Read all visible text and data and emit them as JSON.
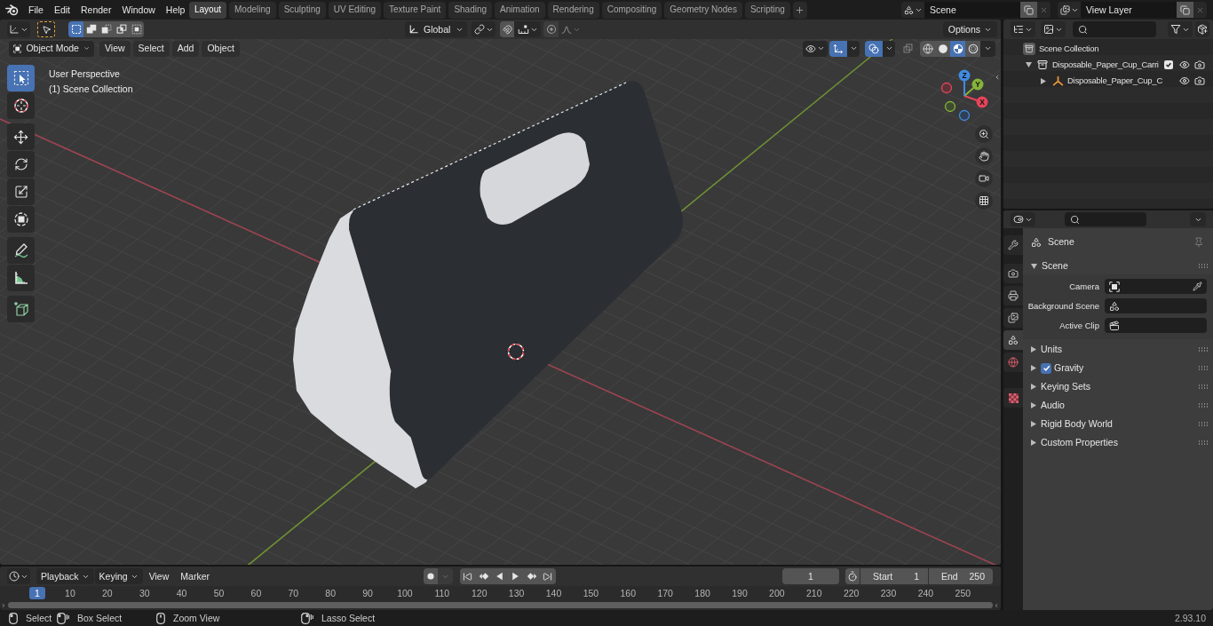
{
  "menu_bar": {
    "menus": [
      "File",
      "Edit",
      "Render",
      "Window",
      "Help"
    ]
  },
  "workspace_tabs": [
    {
      "label": "Layout",
      "selected": true
    },
    {
      "label": "Modeling",
      "selected": false
    },
    {
      "label": "Sculpting",
      "selected": false
    },
    {
      "label": "UV Editing",
      "selected": false
    },
    {
      "label": "Texture Paint",
      "selected": false
    },
    {
      "label": "Shading",
      "selected": false
    },
    {
      "label": "Animation",
      "selected": false
    },
    {
      "label": "Rendering",
      "selected": false
    },
    {
      "label": "Compositing",
      "selected": false
    },
    {
      "label": "Geometry Nodes",
      "selected": false
    },
    {
      "label": "Scripting",
      "selected": false
    }
  ],
  "scene_selector": {
    "value": "Scene"
  },
  "view_layer_selector": {
    "value": "View Layer"
  },
  "viewport": {
    "header": {
      "select_modes": [
        {
          "kind": "set",
          "selected": true
        },
        {
          "kind": "extend",
          "selected": false
        },
        {
          "kind": "subtract",
          "selected": false
        },
        {
          "kind": "invert",
          "selected": false
        },
        {
          "kind": "intersect",
          "selected": false
        }
      ],
      "orientation": "Global",
      "options": "Options",
      "mode": "Object Mode",
      "menus": [
        "View",
        "Select",
        "Add",
        "Object"
      ],
      "gizmos_on": true,
      "overlays_on": true,
      "xray_on": false,
      "shading_modes": [
        {
          "kind": "wireframe",
          "selected": false
        },
        {
          "kind": "solid",
          "selected": false
        },
        {
          "kind": "material",
          "selected": true
        },
        {
          "kind": "rendered",
          "selected": false
        }
      ]
    },
    "overlay_text": [
      "User Perspective",
      "(1) Scene Collection"
    ],
    "tool_groups": [
      {
        "tools": [
          {
            "kind": "select_box",
            "selected": true
          },
          {
            "kind": "cursor",
            "selected": false
          }
        ]
      },
      {
        "tools": [
          {
            "kind": "move",
            "selected": false
          },
          {
            "kind": "rotate",
            "selected": false
          },
          {
            "kind": "scale",
            "selected": false
          },
          {
            "kind": "transform",
            "selected": false
          }
        ]
      },
      {
        "tools": [
          {
            "kind": "annotate",
            "selected": false
          },
          {
            "kind": "measure",
            "selected": false
          }
        ]
      },
      {
        "tools": [
          {
            "kind": "add_cube",
            "selected": false
          }
        ]
      }
    ],
    "nav_gizmo": {
      "axes": [
        "X",
        "Y",
        "Z"
      ]
    }
  },
  "outliner": {
    "tree": [
      {
        "kind": "scene_collection",
        "label": "Scene Collection",
        "children": [
          {
            "kind": "collection",
            "label": "Disposable_Paper_Cup_Carri",
            "expanded": true,
            "checked": true,
            "visible": true,
            "renderable": true,
            "children": [
              {
                "kind": "empty",
                "label": "Disposable_Paper_Cup_C",
                "expanded": false,
                "visible": true,
                "renderable": true
              }
            ]
          }
        ]
      }
    ]
  },
  "properties": {
    "tab_groups": [
      {
        "tabs": [
          {
            "kind": "tool",
            "selected": false
          }
        ]
      },
      {
        "tabs": [
          {
            "kind": "render",
            "selected": false
          },
          {
            "kind": "output",
            "selected": false
          },
          {
            "kind": "view_layer",
            "selected": false
          },
          {
            "kind": "scene",
            "selected": true
          },
          {
            "kind": "world",
            "selected": false
          }
        ]
      },
      {
        "tabs": [
          {
            "kind": "texture",
            "selected": false
          }
        ]
      }
    ],
    "context": "Scene",
    "panels": [
      {
        "title": "Scene",
        "expanded": true,
        "fields": [
          {
            "kind": "camera",
            "label": "Camera"
          },
          {
            "kind": "scene",
            "label": "Background Scene"
          },
          {
            "kind": "clip",
            "label": "Active Clip"
          }
        ]
      },
      {
        "title": "Units",
        "expanded": false
      },
      {
        "title": "Gravity",
        "expanded": false,
        "checked": true
      },
      {
        "title": "Keying Sets",
        "expanded": false
      },
      {
        "title": "Audio",
        "expanded": false
      },
      {
        "title": "Rigid Body World",
        "expanded": false
      },
      {
        "title": "Custom Properties",
        "expanded": false
      }
    ]
  },
  "timeline": {
    "menus": [
      {
        "kind": "dropdown",
        "label": "Playback"
      },
      {
        "kind": "dropdown",
        "label": "Keying"
      },
      {
        "kind": "plain",
        "label": "View"
      },
      {
        "kind": "plain",
        "label": "Marker"
      }
    ],
    "auto_keying_on": false,
    "current_frame": "1",
    "start": {
      "label": "Start",
      "value": "1"
    },
    "end": {
      "label": "End",
      "value": "250"
    },
    "ruler": {
      "current": "1",
      "ticks": [
        "10",
        "20",
        "30",
        "40",
        "50",
        "60",
        "70",
        "80",
        "90",
        "100",
        "110",
        "120",
        "130",
        "140",
        "150",
        "160",
        "170",
        "180",
        "190",
        "200",
        "210",
        "220",
        "230",
        "240",
        "250"
      ]
    }
  },
  "status_bar": {
    "hints": [
      {
        "kind": "left_click",
        "label": "Select"
      },
      {
        "kind": "left_drag",
        "label": "Box Select"
      },
      {
        "kind": "middle_click",
        "label": "Zoom View"
      },
      {
        "kind": "right_drag",
        "label": "Lasso Select"
      }
    ],
    "version": "2.93.10"
  }
}
